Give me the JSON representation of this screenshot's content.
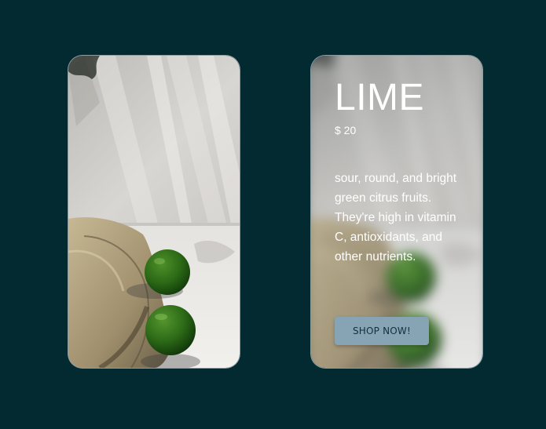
{
  "product": {
    "name": "LIME",
    "price": "$ 20",
    "description": "sour, round, and bright green citrus fruits. They're high in vitamin C, antioxidants, and other nutrients.",
    "cta_label": "SHOP NOW!"
  },
  "colors": {
    "page_background": "#032931",
    "button_background": "#86a4b3",
    "button_text": "#12313a",
    "text": "#ffffff"
  },
  "icons": {
    "product_photo": "limes-on-straw-hat-photo"
  }
}
